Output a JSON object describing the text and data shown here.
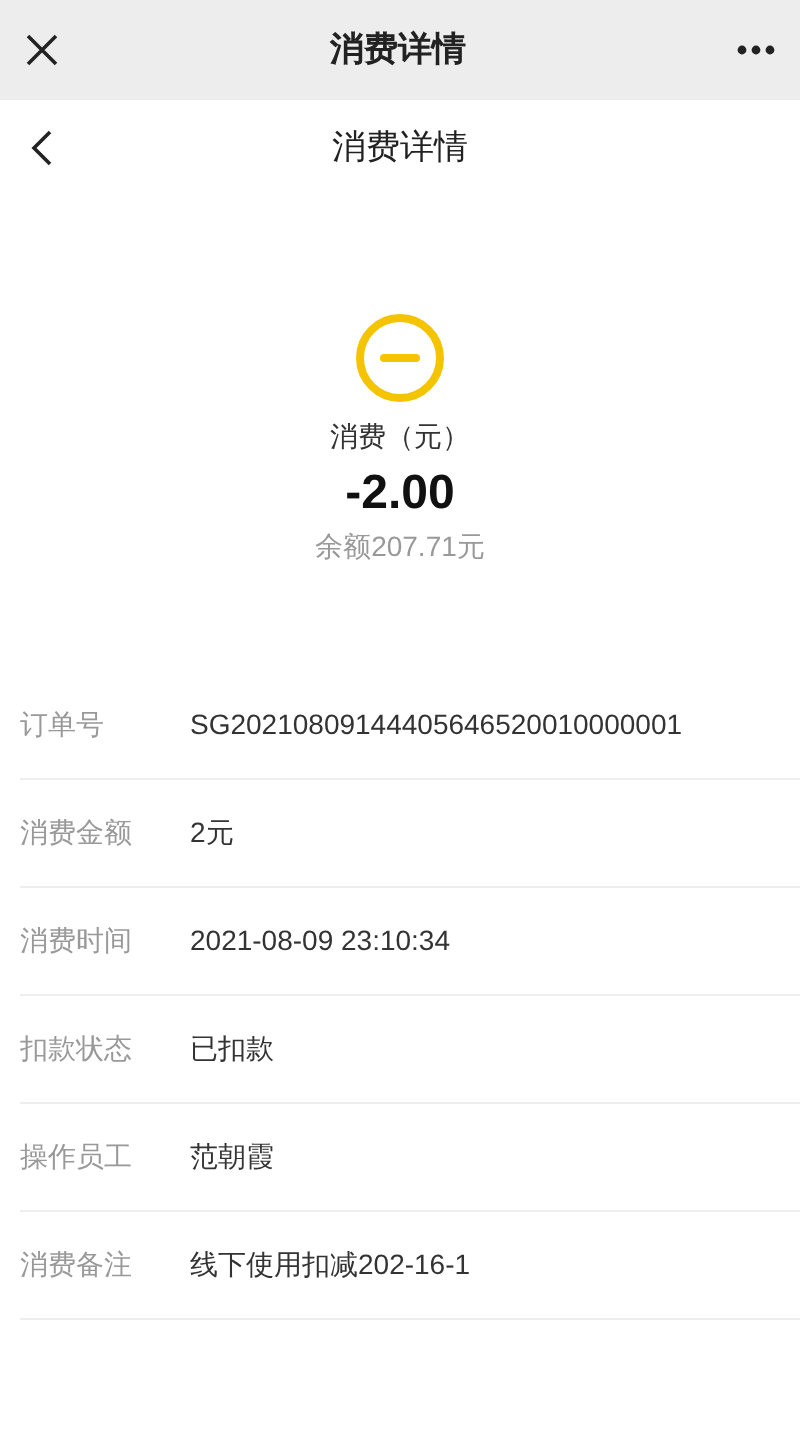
{
  "top_bar": {
    "title": "消费详情"
  },
  "header": {
    "title": "消费详情"
  },
  "summary": {
    "label": "消费（元）",
    "amount": "-2.00",
    "balance": "余额207.71元"
  },
  "details": [
    {
      "label": "订单号",
      "value": "SG20210809144405646520010000001"
    },
    {
      "label": "消费金额",
      "value": "2元"
    },
    {
      "label": "消费时间",
      "value": "2021-08-09 23:10:34"
    },
    {
      "label": "扣款状态",
      "value": "已扣款"
    },
    {
      "label": "操作员工",
      "value": "范朝霞"
    },
    {
      "label": "消费备注",
      "value": "线下使用扣减202-16-1"
    }
  ]
}
